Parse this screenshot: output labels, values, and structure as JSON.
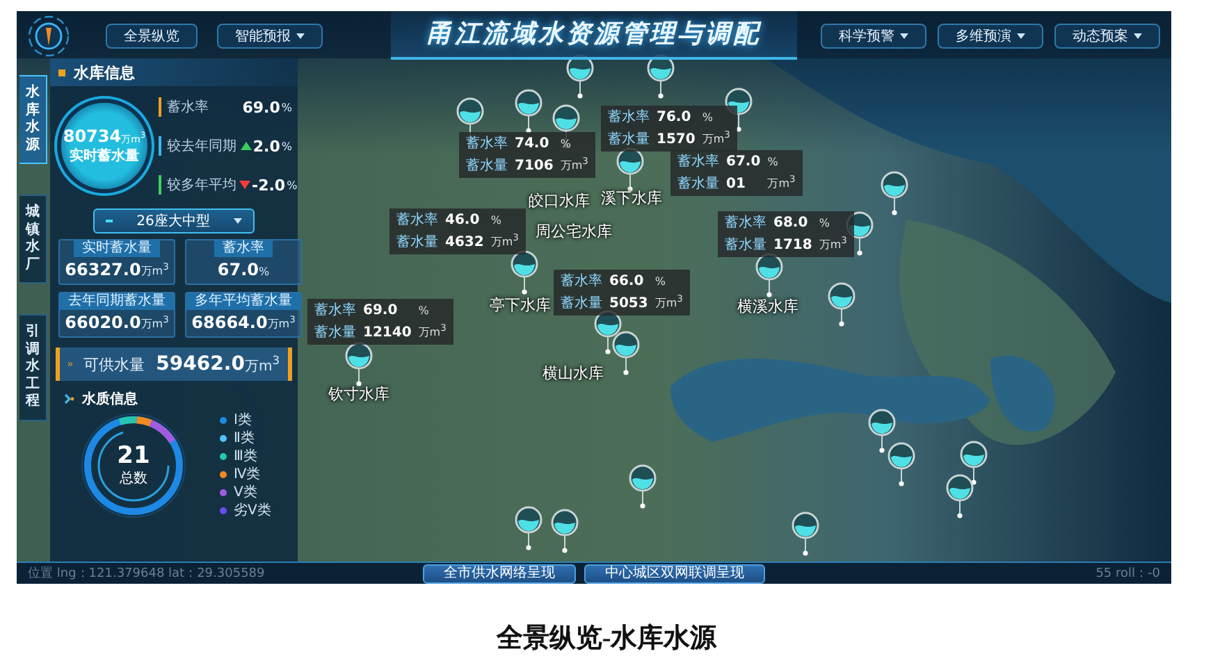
{
  "header": {
    "title": "甬江流域水资源管理与调配",
    "nav_left": [
      {
        "label": "全景纵览",
        "has_menu": false
      },
      {
        "label": "智能预报",
        "has_menu": true
      }
    ],
    "nav_right": [
      {
        "label": "科学预警",
        "has_menu": true
      },
      {
        "label": "多维预演",
        "has_menu": true
      },
      {
        "label": "动态预案",
        "has_menu": true
      }
    ]
  },
  "side_tabs": [
    {
      "label": "水库水源",
      "selected": true
    },
    {
      "label": "城镇水厂",
      "selected": false
    },
    {
      "label": "引调水工程",
      "selected": false
    }
  ],
  "reservoir_panel": {
    "title": "水库信息",
    "total": {
      "value": "80734",
      "unit": "万m$^{3}$",
      "label": "实时蓄水量"
    },
    "stats": [
      {
        "label": "蓄水率",
        "value": "69.0",
        "unit": "%",
        "kind": "plain"
      },
      {
        "label": "较去年同期",
        "value": "2.0",
        "unit": "%",
        "kind": "up"
      },
      {
        "label": "较多年平均",
        "value": "-2.0",
        "unit": "%",
        "kind": "down"
      }
    ],
    "filter": {
      "value": "26座大中型"
    },
    "cards": [
      {
        "title": "实时蓄水量",
        "value": "66327.0",
        "unit": "万m$^{3}$"
      },
      {
        "title": "蓄水率",
        "value": "67.0",
        "unit": "%"
      },
      {
        "title": "去年同期蓄水量",
        "value": "66020.0",
        "unit": "万m$^{3}$"
      },
      {
        "title": "多年平均蓄水量",
        "value": "68664.0",
        "unit": "万m$^{3}$"
      }
    ],
    "supply": {
      "label": "可供水量",
      "value": "59462.0",
      "unit": "万m$^{3}$"
    }
  },
  "water_quality": {
    "title": "水质信息",
    "total": "21",
    "total_label": "总数",
    "legend": [
      {
        "label": "Ⅰ类",
        "color": "#1e88e5"
      },
      {
        "label": "Ⅱ类",
        "color": "#4fc3f7"
      },
      {
        "label": "Ⅲ类",
        "color": "#26c6b0"
      },
      {
        "label": "Ⅳ类",
        "color": "#f08a24"
      },
      {
        "label": "Ⅴ类",
        "color": "#a05ce0"
      },
      {
        "label": "劣Ⅴ类",
        "color": "#6a4cf0"
      }
    ]
  },
  "map": {
    "popups": [
      {
        "rows": [
          {
            "label": "蓄水率",
            "value": "74.0",
            "unit": "%"
          },
          {
            "label": "蓄水量",
            "value": "7106",
            "unit": "万m$^{3}$"
          }
        ]
      },
      {
        "rows": [
          {
            "label": "蓄水率",
            "value": "67.0",
            "unit": "%"
          },
          {
            "label": "蓄水量",
            "value": "01",
            "unit": "万m$^{3}$"
          }
        ]
      },
      {
        "rows": [
          {
            "label": "蓄水率",
            "value": "76.0",
            "unit": "%"
          },
          {
            "label": "蓄水量",
            "value": "1570",
            "unit": "万m$^{3}$"
          }
        ]
      },
      {
        "rows": [
          {
            "label": "蓄水率",
            "value": "46.0",
            "unit": "%"
          },
          {
            "label": "蓄水量",
            "value": "4632",
            "unit": "万m$^{3}$"
          }
        ]
      },
      {
        "rows": [
          {
            "label": "蓄水率",
            "value": "66.0",
            "unit": "%"
          },
          {
            "label": "蓄水量",
            "value": "5053",
            "unit": "万m$^{3}$"
          }
        ]
      },
      {
        "rows": [
          {
            "label": "蓄水率",
            "value": "68.0",
            "unit": "%"
          },
          {
            "label": "蓄水量",
            "value": "1718",
            "unit": "万m$^{3}$"
          }
        ]
      },
      {
        "rows": [
          {
            "label": "蓄水率",
            "value": "69.0",
            "unit": "%"
          },
          {
            "label": "蓄水量",
            "value": "12140",
            "unit": "万m$^{3}$"
          }
        ]
      }
    ],
    "reservoir_labels": [
      "皎口水库",
      "溪下水库",
      "周公宅水库",
      "亭下水库",
      "横溪水库",
      "横山水库",
      "钦寸水库"
    ]
  },
  "status": {
    "coordinates": "位置 lng：121.379648 lat：29.305589",
    "tail": "55 roll：-0"
  },
  "bottom_buttons": [
    "全市供水网络呈现",
    "中心城区双网联调呈现"
  ],
  "caption": "全景纵览-水库水源"
}
